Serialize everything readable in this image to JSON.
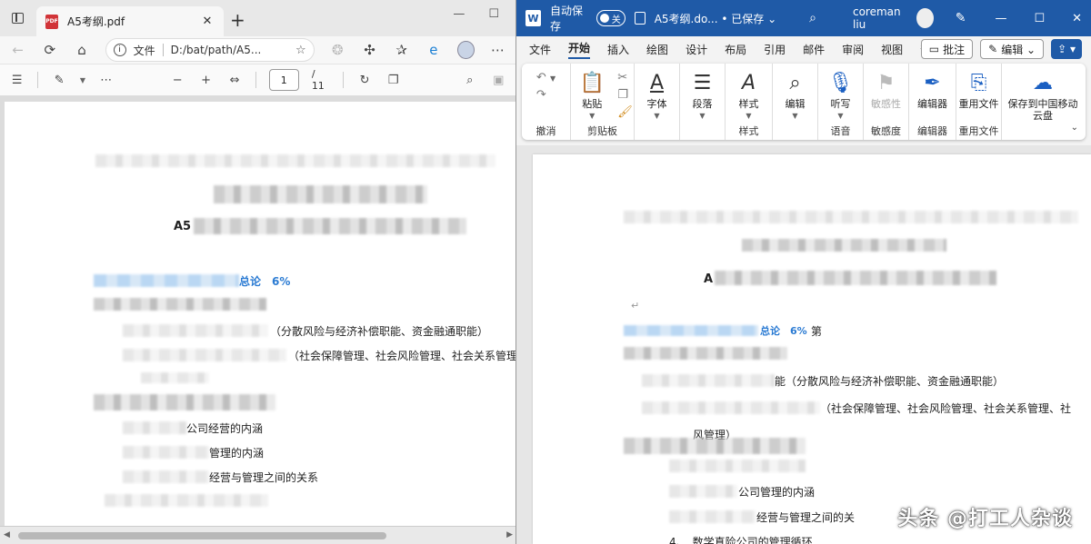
{
  "browser": {
    "tab_title": "A5考纲.pdf",
    "pdf_icon_text": "PDF",
    "address": {
      "label": "文件",
      "url": "D:/bat/path/A5..."
    },
    "pdf_toolbar": {
      "page": "1",
      "total": "/ 11"
    },
    "page_text": {
      "heading_prefix": "A5",
      "blue_line": "总论　6%",
      "line1": "（分散风险与经济补偿职能、资金融通职能）",
      "line2": "（社会保障管理、社会风险管理、社会关系管理",
      "line3": "公司经营的内涵",
      "line4": "管理的内涵",
      "line5": "经营与管理之间的关系"
    }
  },
  "word": {
    "logo": "W",
    "autosave_label": "自动保存",
    "autosave_state": "关",
    "doc_title": "A5考纲.do... • 已保存 ⌄",
    "user": "coreman liu",
    "menus": [
      "文件",
      "开始",
      "插入",
      "绘图",
      "设计",
      "布局",
      "引用",
      "邮件",
      "审阅",
      "视图",
      "帮助"
    ],
    "active_menu": "开始",
    "btn_comment": "批注",
    "btn_edit": "编辑 ⌄",
    "ribbon": {
      "undo_label": "撤消",
      "clipboard": {
        "paste": "粘贴",
        "label": "剪贴板"
      },
      "font": {
        "btn": "字体",
        "label": ""
      },
      "paragraph": {
        "btn": "段落"
      },
      "styles": {
        "btn": "样式",
        "label": "样式"
      },
      "editing": {
        "btn": "编辑"
      },
      "voice": {
        "btn": "听写",
        "label": "语音"
      },
      "sensitivity": {
        "btn": "敏感性",
        "label": "敏感度"
      },
      "editor": {
        "btn": "编辑器",
        "label": "编辑器"
      },
      "reuse": {
        "btn": "重用文件",
        "label": "重用文件"
      },
      "cloud": {
        "btn": "保存到中国移动云盘"
      }
    },
    "page_text": {
      "heading_prefix": "A",
      "blue_line": "总论　6%",
      "blue_suffix": "第",
      "line1": "能（分散风险与经济补偿职能、资金融通职能）",
      "line2": "（社会保障管理、社会风险管理、社会关系管理、社",
      "line3": "风管理）",
      "line4": "公司管理的内涵",
      "line5": "经营与管理之间的关",
      "line6": "4、　数学真险公司的管理循环"
    },
    "return_mark": "↵"
  },
  "watermark": "头条 @打工人杂谈"
}
